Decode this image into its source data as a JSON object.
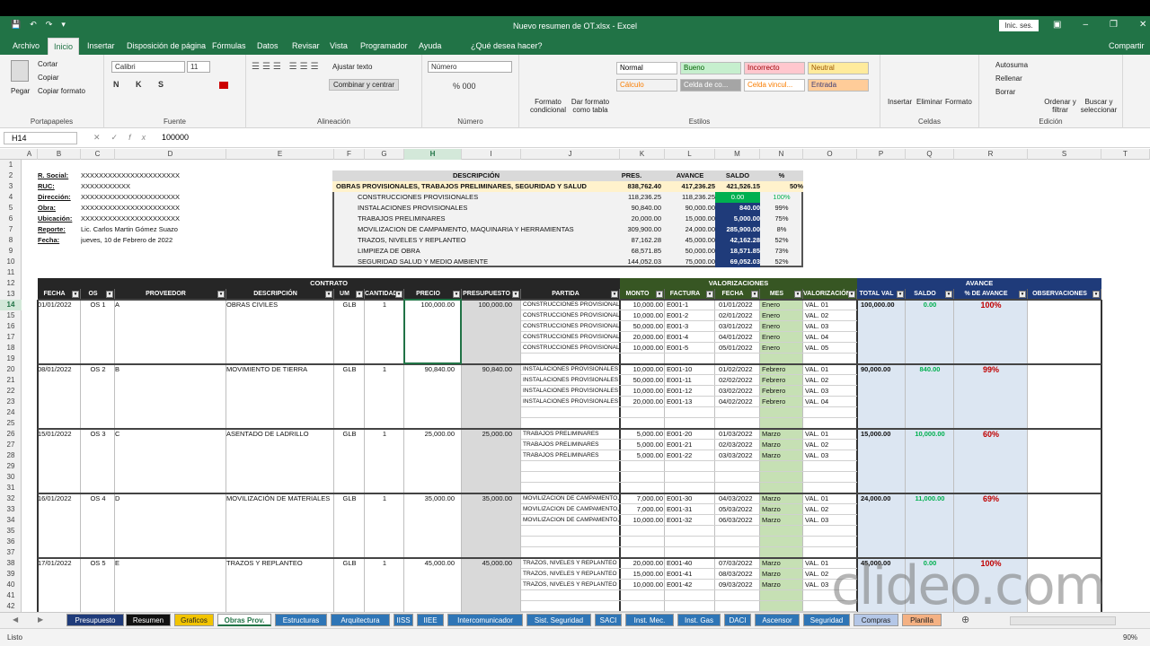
{
  "window": {
    "title": "Nuevo resumen de OT.xlsx  -  Excel",
    "signin": "Inic. ses."
  },
  "menu": [
    "Archivo",
    "Inicio",
    "Insertar",
    "Disposición de página",
    "Fórmulas",
    "Datos",
    "Revisar",
    "Vista",
    "Programador",
    "Ayuda",
    "¿Qué desea hacer?"
  ],
  "share": "Compartir",
  "ribbon": {
    "clipboard": {
      "paste": "Pegar",
      "cut": "Cortar",
      "copy": "Copiar",
      "format_painter": "Copiar formato",
      "label": "Portapapeles"
    },
    "font": {
      "name": "Calibri",
      "size": "11",
      "label": "Fuente"
    },
    "alignment": {
      "wrap": "Ajustar texto",
      "merge": "Combinar y centrar",
      "label": "Alineación"
    },
    "number": {
      "format": "Número",
      "label": "Número"
    },
    "styles": {
      "cond": "Formato condicional",
      "table": "Dar formato como tabla",
      "label": "Estilos",
      "cells": [
        "Normal",
        "Bueno",
        "Incorrecto",
        "Neutral",
        "Cálculo",
        "Celda de co...",
        "Celda vincul...",
        "Entrada"
      ]
    },
    "cells": {
      "insert": "Insertar",
      "delete": "Eliminar",
      "format": "Formato",
      "label": "Celdas"
    },
    "editing": {
      "autosum": "Autosuma",
      "fill": "Rellenar",
      "clear": "Borrar",
      "sort": "Ordenar y filtrar",
      "find": "Buscar y seleccionar",
      "label": "Edición"
    }
  },
  "formula": {
    "namebox": "H14",
    "value": "100000"
  },
  "columns": [
    "A",
    "B",
    "C",
    "D",
    "E",
    "F",
    "G",
    "H",
    "I",
    "J",
    "K",
    "L",
    "M",
    "N",
    "O",
    "P",
    "Q",
    "R",
    "S",
    "T"
  ],
  "rows": [
    "1",
    "2",
    "3",
    "4",
    "5",
    "6",
    "7",
    "8",
    "9",
    "10",
    "11",
    "12",
    "13",
    "14",
    "15",
    "16",
    "17",
    "18",
    "19",
    "20",
    "21",
    "22",
    "23",
    "24",
    "25",
    "26",
    "27",
    "28",
    "29",
    "30",
    "31",
    "32",
    "33",
    "34",
    "35",
    "36",
    "37",
    "38",
    "39",
    "40",
    "41",
    "42"
  ],
  "info": [
    {
      "label": "R. Social:",
      "value": "XXXXXXXXXXXXXXXXXXXXXX"
    },
    {
      "label": "RUC:",
      "value": "XXXXXXXXXXX"
    },
    {
      "label": "Dirección:",
      "value": "XXXXXXXXXXXXXXXXXXXXXX"
    },
    {
      "label": "Obra:",
      "value": "XXXXXXXXXXXXXXXXXXXXXX"
    },
    {
      "label": "Ubicación:",
      "value": "XXXXXXXXXXXXXXXXXXXXXX"
    },
    {
      "label": "Reporte:",
      "value": "Lic. Carlos Martin Gómez Suazo"
    },
    {
      "label": "Fecha:",
      "value": "jueves, 10 de Febrero de 2022"
    }
  ],
  "summary": {
    "headers": [
      "DESCRIPCIÓN",
      "PRES.",
      "AVANCE",
      "SALDO",
      "%"
    ],
    "total": {
      "desc": "OBRAS PROVISIONALES, TRABAJOS PRELIMINARES, SEGURIDAD Y SALUD",
      "pres": "838,762.40",
      "avance": "417,236.25",
      "saldo": "421,526.15",
      "pct": "50%"
    },
    "rows": [
      {
        "desc": "CONSTRUCCIONES PROVISIONALES",
        "pres": "118,236.25",
        "avance": "118,236.25",
        "saldo": "0.00",
        "pct": "100%"
      },
      {
        "desc": "INSTALACIONES PROVISIONALES",
        "pres": "90,840.00",
        "avance": "90,000.00",
        "saldo": "840.00",
        "pct": "99%"
      },
      {
        "desc": "TRABAJOS PRELIMINARES",
        "pres": "20,000.00",
        "avance": "15,000.00",
        "saldo": "5,000.00",
        "pct": "75%"
      },
      {
        "desc": "MOVILIZACION DE CAMPAMENTO, MAQUINARIA Y HERRAMIENTAS",
        "pres": "309,900.00",
        "avance": "24,000.00",
        "saldo": "285,900.00",
        "pct": "8%"
      },
      {
        "desc": "TRAZOS, NIVELES Y REPLANTEO",
        "pres": "87,162.28",
        "avance": "45,000.00",
        "saldo": "42,162.28",
        "pct": "52%"
      },
      {
        "desc": "LIMPIEZA DE OBRA",
        "pres": "68,571.85",
        "avance": "50,000.00",
        "saldo": "18,571.85",
        "pct": "73%"
      },
      {
        "desc": "SEGURIDAD SALUD Y MEDIO AMBIENTE",
        "pres": "144,052.03",
        "avance": "75,000.00",
        "saldo": "69,052.03",
        "pct": "52%"
      }
    ]
  },
  "bands": {
    "contrato": "CONTRATO",
    "valorizaciones": "VALORIZACIONES",
    "avance": "AVANCE"
  },
  "table_headers": [
    "FECHA",
    "OS",
    "PROVEEDOR",
    "DESCRIPCIÓN",
    "UM",
    "CANTIDAD",
    "PRECIO",
    "PRESUPUESTO",
    "PARTIDA",
    "MONTO",
    "FACTURA",
    "FECHA",
    "MES",
    "VALORIZACIÓN",
    "TOTAL VAL",
    "SALDO",
    "% DE AVANCE",
    "OBSERVACIONES"
  ],
  "contracts": [
    {
      "fecha": "01/01/2022",
      "os": "OS 1",
      "prov": "A",
      "desc": "OBRAS CIVILES",
      "um": "GLB",
      "cant": "1",
      "precio": "100,000.00",
      "pres": "100,000.00",
      "total": "100,000.00",
      "saldo": "0.00",
      "pct": "100%",
      "vals": [
        {
          "partida": "CONSTRUCCIONES PROVISIONALES",
          "monto": "10,000.00",
          "fac": "E001-1",
          "fecha": "01/01/2022",
          "mes": "Enero",
          "val": "VAL. 01"
        },
        {
          "partida": "CONSTRUCCIONES PROVISIONALES",
          "monto": "10,000.00",
          "fac": "E001-2",
          "fecha": "02/01/2022",
          "mes": "Enero",
          "val": "VAL. 02"
        },
        {
          "partida": "CONSTRUCCIONES PROVISIONALES",
          "monto": "50,000.00",
          "fac": "E001-3",
          "fecha": "03/01/2022",
          "mes": "Enero",
          "val": "VAL. 03"
        },
        {
          "partida": "CONSTRUCCIONES PROVISIONALES",
          "monto": "20,000.00",
          "fac": "E001-4",
          "fecha": "04/01/2022",
          "mes": "Enero",
          "val": "VAL. 04"
        },
        {
          "partida": "CONSTRUCCIONES PROVISIONALES",
          "monto": "10,000.00",
          "fac": "E001-5",
          "fecha": "05/01/2022",
          "mes": "Enero",
          "val": "VAL. 05"
        }
      ]
    },
    {
      "fecha": "08/01/2022",
      "os": "OS 2",
      "prov": "B",
      "desc": "MOVIMIENTO DE TIERRA",
      "um": "GLB",
      "cant": "1",
      "precio": "90,840.00",
      "pres": "90,840.00",
      "total": "90,000.00",
      "saldo": "840.00",
      "pct": "99%",
      "vals": [
        {
          "partida": "INSTALACIONES PROVISIONALES",
          "monto": "10,000.00",
          "fac": "E001-10",
          "fecha": "01/02/2022",
          "mes": "Febrero",
          "val": "VAL. 01"
        },
        {
          "partida": "INSTALACIONES PROVISIONALES",
          "monto": "50,000.00",
          "fac": "E001-11",
          "fecha": "02/02/2022",
          "mes": "Febrero",
          "val": "VAL. 02"
        },
        {
          "partida": "INSTALACIONES PROVISIONALES",
          "monto": "10,000.00",
          "fac": "E001-12",
          "fecha": "03/02/2022",
          "mes": "Febrero",
          "val": "VAL. 03"
        },
        {
          "partida": "INSTALACIONES PROVISIONALES",
          "monto": "20,000.00",
          "fac": "E001-13",
          "fecha": "04/02/2022",
          "mes": "Febrero",
          "val": "VAL. 04"
        }
      ]
    },
    {
      "fecha": "15/01/2022",
      "os": "OS 3",
      "prov": "C",
      "desc": "ASENTADO DE LADRILLO",
      "um": "GLB",
      "cant": "1",
      "precio": "25,000.00",
      "pres": "25,000.00",
      "total": "15,000.00",
      "saldo": "10,000.00",
      "pct": "60%",
      "vals": [
        {
          "partida": "TRABAJOS PRELIMINARES",
          "monto": "5,000.00",
          "fac": "E001-20",
          "fecha": "01/03/2022",
          "mes": "Marzo",
          "val": "VAL. 01"
        },
        {
          "partida": "TRABAJOS PRELIMINARES",
          "monto": "5,000.00",
          "fac": "E001-21",
          "fecha": "02/03/2022",
          "mes": "Marzo",
          "val": "VAL. 02"
        },
        {
          "partida": "TRABAJOS PRELIMINARES",
          "monto": "5,000.00",
          "fac": "E001-22",
          "fecha": "03/03/2022",
          "mes": "Marzo",
          "val": "VAL. 03"
        }
      ]
    },
    {
      "fecha": "16/01/2022",
      "os": "OS 4",
      "prov": "D",
      "desc": "MOVILIZACIÓN DE MATERIALES",
      "um": "GLB",
      "cant": "1",
      "precio": "35,000.00",
      "pres": "35,000.00",
      "total": "24,000.00",
      "saldo": "11,000.00",
      "pct": "69%",
      "vals": [
        {
          "partida": "MOVILIZACION DE CAMPAMENTO, M",
          "monto": "7,000.00",
          "fac": "E001-30",
          "fecha": "04/03/2022",
          "mes": "Marzo",
          "val": "VAL. 01"
        },
        {
          "partida": "MOVILIZACION DE CAMPAMENTO, M",
          "monto": "7,000.00",
          "fac": "E001-31",
          "fecha": "05/03/2022",
          "mes": "Marzo",
          "val": "VAL. 02"
        },
        {
          "partida": "MOVILIZACION DE CAMPAMENTO, M",
          "monto": "10,000.00",
          "fac": "E001-32",
          "fecha": "06/03/2022",
          "mes": "Marzo",
          "val": "VAL. 03"
        }
      ]
    },
    {
      "fecha": "17/01/2022",
      "os": "OS 5",
      "prov": "E",
      "desc": "TRAZOS Y REPLANTEO",
      "um": "GLB",
      "cant": "1",
      "precio": "45,000.00",
      "pres": "45,000.00",
      "total": "45,000.00",
      "saldo": "0.00",
      "pct": "100%",
      "vals": [
        {
          "partida": "TRAZOS, NIVELES Y REPLANTEO",
          "monto": "20,000.00",
          "fac": "E001-40",
          "fecha": "07/03/2022",
          "mes": "Marzo",
          "val": "VAL. 01"
        },
        {
          "partida": "TRAZOS, NIVELES Y REPLANTEO",
          "monto": "15,000.00",
          "fac": "E001-41",
          "fecha": "08/03/2022",
          "mes": "Marzo",
          "val": "VAL. 02"
        },
        {
          "partida": "TRAZOS, NIVELES Y REPLANTEO",
          "monto": "10,000.00",
          "fac": "E001-42",
          "fecha": "09/03/2022",
          "mes": "Marzo",
          "val": "VAL. 03"
        }
      ]
    }
  ],
  "sheet_tabs": [
    {
      "name": "Presupuesto",
      "color": "#1f3b7a"
    },
    {
      "name": "Resumen",
      "color": "#111111"
    },
    {
      "name": "Graficos",
      "color": "#f2c400"
    },
    {
      "name": "Obras Prov.",
      "color": "#ffffff"
    },
    {
      "name": "Estructuras",
      "color": "#2e75b6"
    },
    {
      "name": "Arquitectura",
      "color": "#2e75b6"
    },
    {
      "name": "IISS",
      "color": "#2e75b6"
    },
    {
      "name": "IIEE",
      "color": "#2e75b6"
    },
    {
      "name": "Intercomunicador",
      "color": "#2e75b6"
    },
    {
      "name": "Sist. Seguridad",
      "color": "#2e75b6"
    },
    {
      "name": "SACI",
      "color": "#2e75b6"
    },
    {
      "name": "Inst. Mec.",
      "color": "#2e75b6"
    },
    {
      "name": "Inst. Gas",
      "color": "#2e75b6"
    },
    {
      "name": "DACI",
      "color": "#2e75b6"
    },
    {
      "name": "Ascensor",
      "color": "#2e75b6"
    },
    {
      "name": "Seguridad",
      "color": "#2e75b6"
    },
    {
      "name": "Compras",
      "color": "#b4c7e7"
    },
    {
      "name": "Planilla",
      "color": "#f4b183"
    }
  ],
  "status": {
    "ready": "Listo",
    "zoom": "90%"
  },
  "watermark": "clideo.com"
}
